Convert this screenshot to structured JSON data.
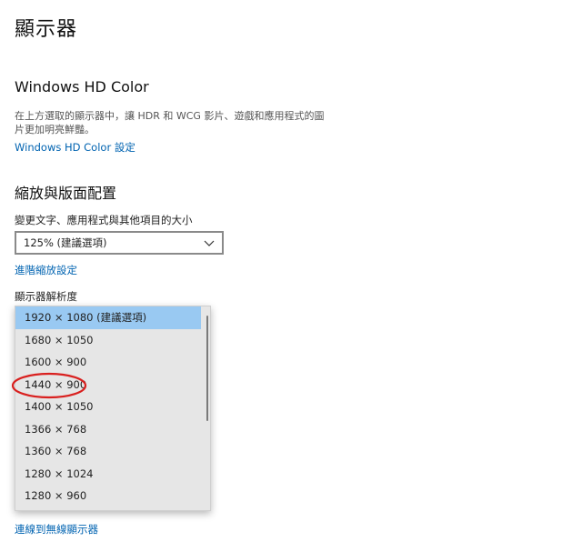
{
  "page": {
    "title": "顯示器"
  },
  "hd_color": {
    "title": "Windows HD Color",
    "description": "在上方選取的顯示器中，讓 HDR 和 WCG 影片、遊戲和應用程式的圖片更加明亮鮮豔。",
    "settings_link": "Windows HD Color 設定"
  },
  "scale_layout": {
    "title": "縮放與版面配置",
    "size_label": "變更文字、應用程式與其他項目的大小",
    "size_selected": "125% (建議選項)",
    "advanced_link": "進階縮放設定",
    "resolution_label": "顯示器解析度",
    "resolution_options": [
      "1920 × 1080 (建議選項)",
      "1680 × 1050",
      "1600 × 900",
      "1440 × 900",
      "1400 × 1050",
      "1366 × 768",
      "1360 × 768",
      "1280 × 1024",
      "1280 × 960"
    ],
    "resolution_highlighted_index": 0
  },
  "wireless_link": "連線到無線顯示器",
  "colors": {
    "link": "#0063b1",
    "selected": "#99c9f2",
    "annotation": "#d9201f"
  }
}
